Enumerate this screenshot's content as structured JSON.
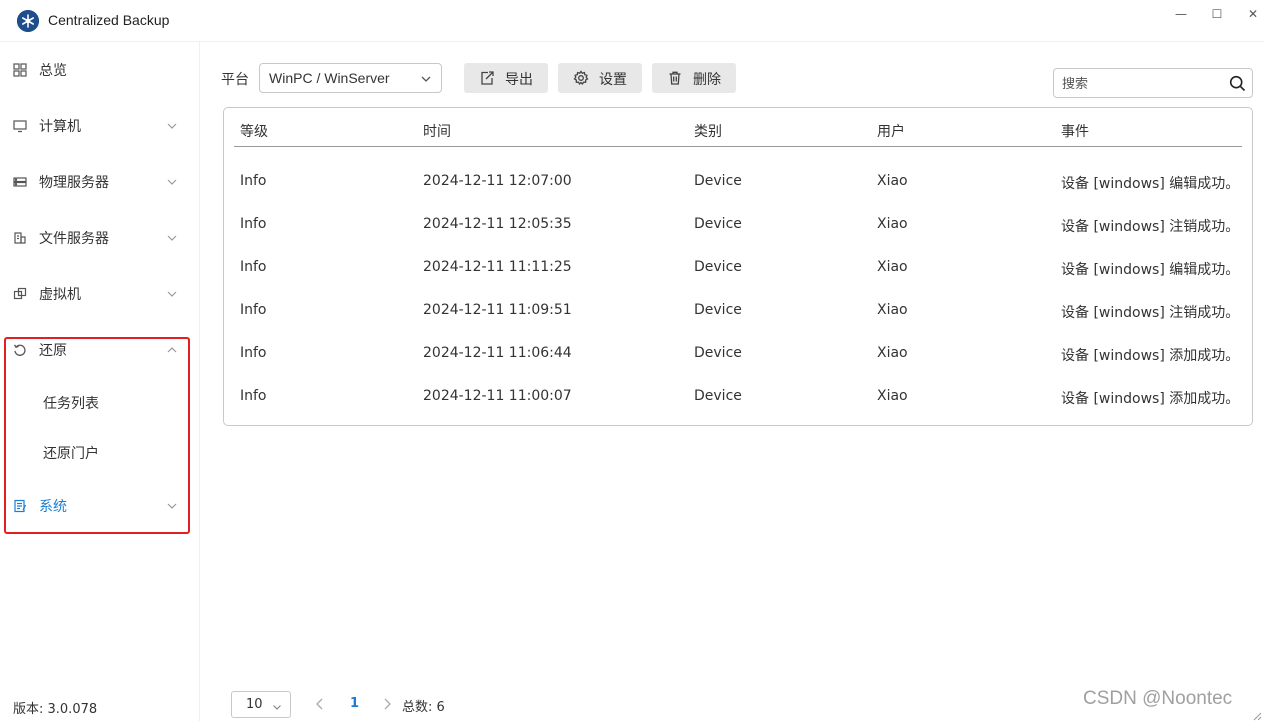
{
  "window": {
    "title": "Centralized Backup",
    "minimize_glyph": "—",
    "maximize_glyph": "☐",
    "close_glyph": "✕"
  },
  "sidebar": {
    "items": [
      {
        "label": "总览",
        "icon": "dashboard-icon",
        "expandable": false
      },
      {
        "label": "计算机",
        "icon": "monitor-icon",
        "expandable": true
      },
      {
        "label": "物理服务器",
        "icon": "server-icon",
        "expandable": true
      },
      {
        "label": "文件服务器",
        "icon": "file-server-icon",
        "expandable": true
      },
      {
        "label": "虚拟机",
        "icon": "virtual-machine-icon",
        "expandable": true
      },
      {
        "label": "还原",
        "icon": "restore-icon",
        "expandable": true,
        "expanded": true
      },
      {
        "label": "系统",
        "icon": "system-icon",
        "expandable": true,
        "active": true
      }
    ],
    "restore_subitems": [
      {
        "label": "任务列表"
      },
      {
        "label": "还原门户"
      }
    ],
    "version": "版本: 3.0.078",
    "active_color": "#1a7fd4",
    "highlight_color": "#e02020"
  },
  "toolbar": {
    "platform_label": "平台",
    "platform_value": "WinPC / WinServer",
    "export_label": "导出",
    "settings_label": "设置",
    "delete_label": "删除",
    "search_placeholder": "搜索"
  },
  "table": {
    "columns": [
      "等级",
      "时间",
      "类别",
      "用户",
      "事件"
    ],
    "rows": [
      [
        "Info",
        "2024-12-11 12:07:00",
        "Device",
        "Xiao",
        "设备 [windows] 编辑成功。"
      ],
      [
        "Info",
        "2024-12-11 12:05:35",
        "Device",
        "Xiao",
        "设备 [windows] 注销成功。"
      ],
      [
        "Info",
        "2024-12-11 11:11:25",
        "Device",
        "Xiao",
        "设备 [windows] 编辑成功。"
      ],
      [
        "Info",
        "2024-12-11 11:09:51",
        "Device",
        "Xiao",
        "设备 [windows] 注销成功。"
      ],
      [
        "Info",
        "2024-12-11 11:06:44",
        "Device",
        "Xiao",
        "设备 [windows] 添加成功。"
      ],
      [
        "Info",
        "2024-12-11 11:00:07",
        "Device",
        "Xiao",
        "设备 [windows] 添加成功。"
      ]
    ]
  },
  "pagination": {
    "page_size": "10",
    "current_page": "1",
    "total": "总数: 6"
  },
  "watermark": "CSDN @Noontec"
}
